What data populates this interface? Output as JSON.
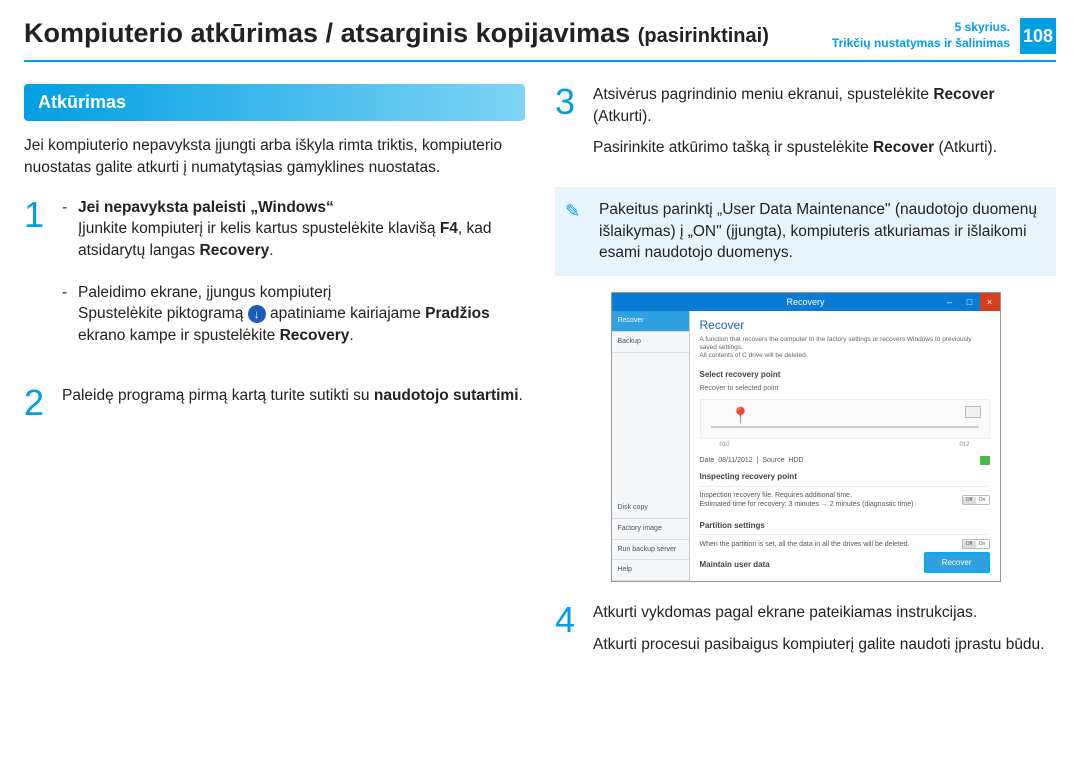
{
  "header": {
    "title_main": "Kompiuterio atkūrimas / atsarginis kopijavimas",
    "title_sub": "(pasirinktinai)",
    "chapter_line1": "5 skyrius.",
    "chapter_line2": "Trikčių nustatymas ir šalinimas",
    "page": "108"
  },
  "left": {
    "section_heading": "Atkūrimas",
    "intro": "Jei kompiuterio nepavyksta įjungti arba iškyla rimta triktis, kompiuterio nuostatas galite atkurti į numatytąsias gamyklines nuostatas.",
    "step1": {
      "num": "1",
      "b1_title": "Jei nepavyksta paleisti „Windows“",
      "b1_p_pre": "Įjunkite kompiuterį ir kelis kartus spustelėkite klavišą ",
      "b1_key": "F4",
      "b1_p_mid": ", kad atsidarytų langas ",
      "b1_word": "Recovery",
      "b1_p_end": ".",
      "b2_title": "Paleidimo ekrane, įjungus kompiuterį",
      "b2_p_a": "Spustelėkite piktogramą ",
      "b2_p_b": " apatiniame kairiajame ",
      "b2_bold1": "Pradžios",
      "b2_p_c": " ekrano kampe ir spustelėkite ",
      "b2_bold2": "Recovery",
      "b2_p_d": "."
    },
    "step2": {
      "num": "2",
      "text_a": "Paleidę programą pirmą kartą turite sutikti su ",
      "bold": "naudotojo sutartimi",
      "text_b": "."
    }
  },
  "right": {
    "step3": {
      "num": "3",
      "p1_a": "Atsivėrus pagrindinio meniu ekranui, spustelėkite ",
      "p1_bold": "Recover",
      "p1_b": " (Atkurti).",
      "p2_a": "Pasirinkite atkūrimo tašką ir spustelėkite ",
      "p2_bold": "Recover",
      "p2_b": " (Atkurti)."
    },
    "note": "Pakeitus parinktį „User Data Maintenance\" (naudotojo duomenų išlaikymas) į „ON\" (įjungta), kompiuteris atkuriamas ir išlaikomi esami naudotojo duomenys.",
    "step4": {
      "num": "4",
      "p1": "Atkurti vykdomas pagal ekrane pateikiamas instrukcijas.",
      "p2": "Atkurti procesui pasibaigus kompiuterį galite naudoti įprastu būdu."
    }
  },
  "screenshot": {
    "titlebar": "Recovery",
    "sidebar": {
      "recover": "Recover",
      "backup": "Backup",
      "diskcopy": "Disk copy",
      "factory": "Factory image",
      "runbackup": "Run backup server",
      "help": "Help"
    },
    "main_title": "Recover",
    "main_desc1": "A function that recovers the computer to the factory settings or recovers Windows to previously saved settings.",
    "main_desc2": "All contents of C drive will be deleted.",
    "sect_select": "Select recovery point",
    "sub_select": "Recover to selected point",
    "tl_a": "010",
    "tl_b": "012",
    "info_date_label": "Date",
    "info_date": "08/11/2012",
    "info_source_label": "Source",
    "info_source": "HDD",
    "sect_inspect": "Inspecting recovery point",
    "inspect_l1": "Inspection recovery file. Requires additional time.",
    "inspect_l2": "Estimated time for recovery: 3 minutes → 2 minutes (diagnostic time)",
    "sect_partition": "Partition settings",
    "partition_text": "When the partition is set, all the data in all the drives will be deleted.",
    "sect_maintain": "Maintain user data",
    "toggle_off": "Off",
    "toggle_on": "On",
    "recover_btn": "Recover"
  }
}
